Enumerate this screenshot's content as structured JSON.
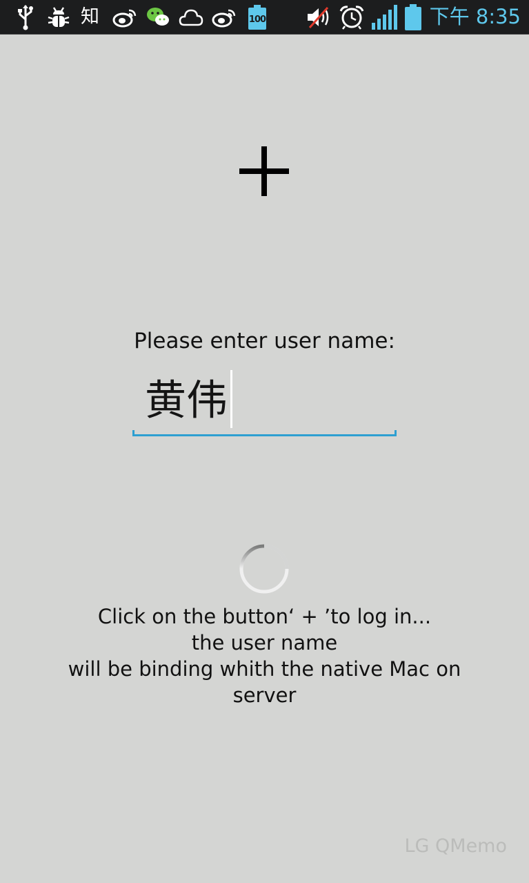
{
  "status_bar": {
    "left_icons": [
      "usb-icon",
      "debug-icon",
      "zhihu-icon",
      "weibo-icon",
      "wechat-icon",
      "cloud-icon",
      "weibo-icon",
      "battery-100-icon"
    ],
    "zhihu_text": "知",
    "battery_level_text": "100",
    "right_icons": [
      "sound-muted-icon",
      "alarm-clock-icon",
      "signal-icon",
      "battery-icon"
    ],
    "time": "下午 8:35",
    "accent_color": "#5ec8ec"
  },
  "login": {
    "add_button_label": "+",
    "prompt": "Please enter user name:",
    "username_value": "黄伟",
    "accent_color": "#2d9fd1"
  },
  "hint": {
    "lines": [
      "Click on the button‘ + ’to log in...",
      "the user name",
      "will be binding whith the native Mac on",
      "server"
    ]
  },
  "watermark": "LG QMemo"
}
